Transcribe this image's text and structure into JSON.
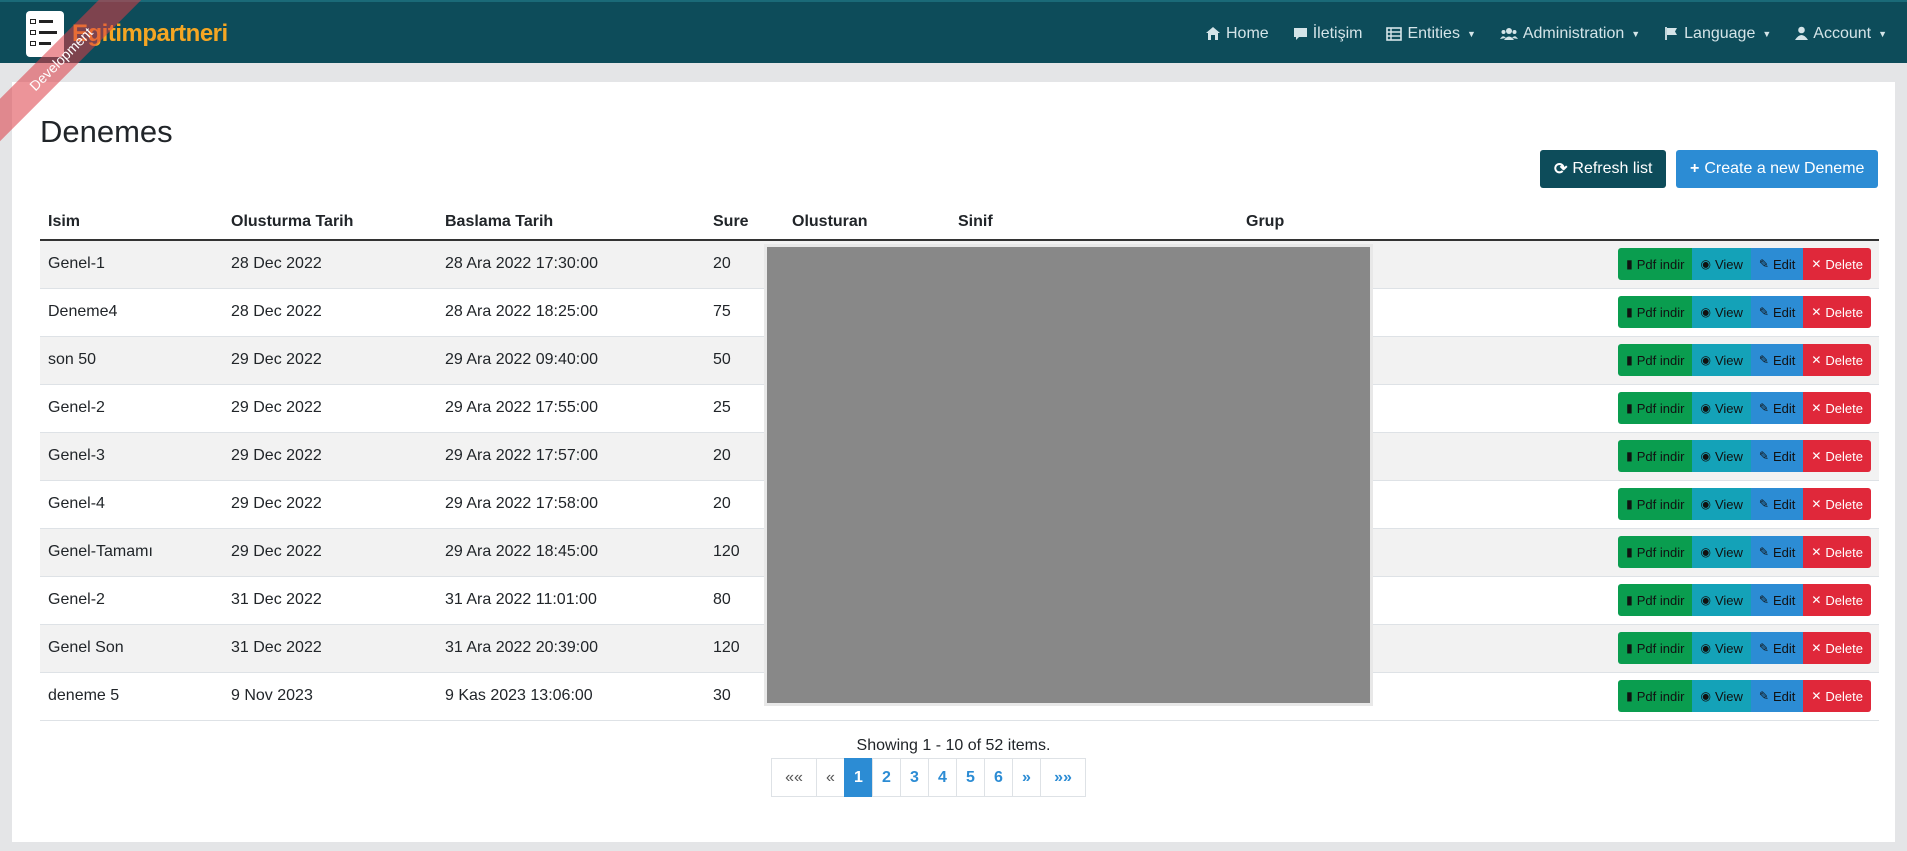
{
  "brand": {
    "name": "Egitimpartneri",
    "ribbon": "Development"
  },
  "nav": [
    {
      "label": "Home",
      "icon": "home-icon",
      "dropdown": false
    },
    {
      "label": "İletişim",
      "icon": "comment-icon",
      "dropdown": false
    },
    {
      "label": "Entities",
      "icon": "list-icon",
      "dropdown": true
    },
    {
      "label": "Administration",
      "icon": "users-icon",
      "dropdown": true
    },
    {
      "label": "Language",
      "icon": "flag-icon",
      "dropdown": true
    },
    {
      "label": "Account",
      "icon": "user-icon",
      "dropdown": true
    }
  ],
  "page": {
    "title": "Denemes",
    "refresh_label": "Refresh list",
    "create_label": "Create a new Deneme"
  },
  "table": {
    "headers": [
      "Isim",
      "Olusturma Tarih",
      "Baslama Tarih",
      "Sure",
      "Olusturan",
      "Sinif",
      "Grup",
      ""
    ],
    "rows": [
      {
        "isim": "Genel-1",
        "olusturma": "28 Dec 2022",
        "baslama": "28 Ara 2022 17:30:00",
        "sure": "20"
      },
      {
        "isim": "Deneme4",
        "olusturma": "28 Dec 2022",
        "baslama": "28 Ara 2022 18:25:00",
        "sure": "75"
      },
      {
        "isim": "son 50",
        "olusturma": "29 Dec 2022",
        "baslama": "29 Ara 2022 09:40:00",
        "sure": "50"
      },
      {
        "isim": "Genel-2",
        "olusturma": "29 Dec 2022",
        "baslama": "29 Ara 2022 17:55:00",
        "sure": "25"
      },
      {
        "isim": "Genel-3",
        "olusturma": "29 Dec 2022",
        "baslama": "29 Ara 2022 17:57:00",
        "sure": "20"
      },
      {
        "isim": "Genel-4",
        "olusturma": "29 Dec 2022",
        "baslama": "29 Ara 2022 17:58:00",
        "sure": "20"
      },
      {
        "isim": "Genel-Tamamı",
        "olusturma": "29 Dec 2022",
        "baslama": "29 Ara 2022 18:45:00",
        "sure": "120"
      },
      {
        "isim": "Genel-2",
        "olusturma": "31 Dec 2022",
        "baslama": "31 Ara 2022 11:01:00",
        "sure": "80"
      },
      {
        "isim": "Genel Son",
        "olusturma": "31 Dec 2022",
        "baslama": "31 Ara 2022 20:39:00",
        "sure": "120"
      },
      {
        "isim": "deneme 5",
        "olusturma": "9 Nov 2023",
        "baslama": "9 Kas 2023 13:06:00",
        "sure": "30"
      }
    ],
    "actions": {
      "pdf": "Pdf indir",
      "view": "View",
      "edit": "Edit",
      "delete": "Delete"
    }
  },
  "pagination": {
    "info": "Showing 1 - 10 of 52 items.",
    "first": "««",
    "prev": "«",
    "pages": [
      "1",
      "2",
      "3",
      "4",
      "5",
      "6"
    ],
    "active": "1",
    "next": "»",
    "last": "»»"
  },
  "colors": {
    "navbar": "#0d4c5a",
    "brand": "#f5a623",
    "primary": "#2c8cd4",
    "success": "#0a9d4f",
    "info": "#14a2b8",
    "danger": "#e0283a"
  }
}
